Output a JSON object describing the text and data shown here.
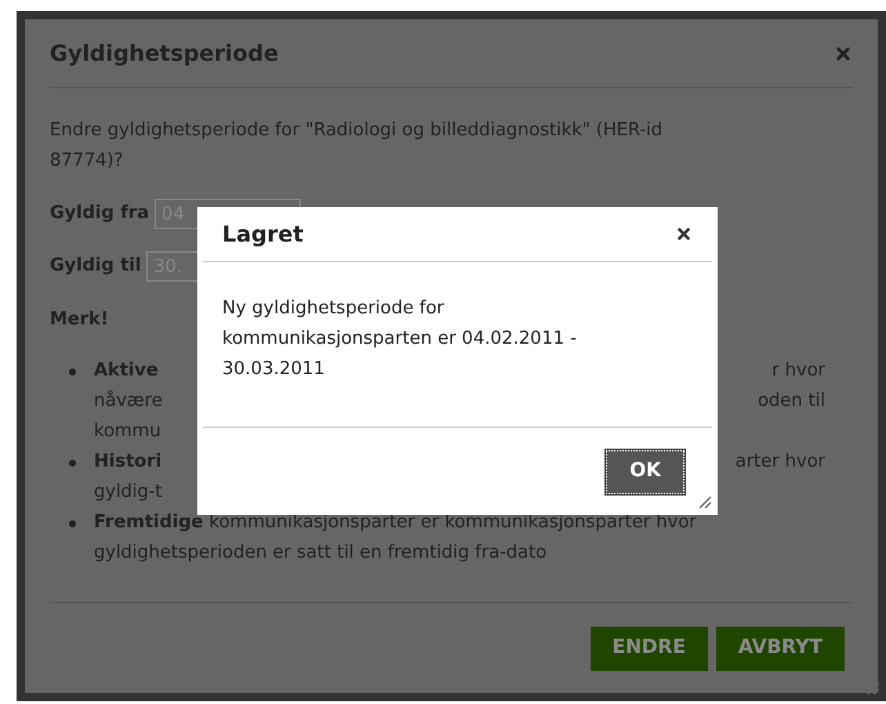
{
  "dialog": {
    "title": "Gyldighetsperiode",
    "question": "Endre gyldighetsperiode for \"Radiologi og billeddiagnostikk\" (HER-id 87774)?",
    "fields": [
      {
        "label": "Gyldig fra",
        "value": "04"
      },
      {
        "label": "Gyldig til",
        "value": "30."
      }
    ],
    "note_heading": "Merk!",
    "bullets": [
      {
        "lines": [
          {
            "term": "Aktive",
            "right": "r hvor"
          },
          {
            "left": "nåvære",
            "right": "oden til"
          },
          {
            "left": "kommu"
          }
        ]
      },
      {
        "lines": [
          {
            "term": "Histori",
            "right": "arter hvor"
          },
          {
            "left": "gyldig-t"
          }
        ]
      },
      {
        "term": "Fremtidige",
        "text": "kommunikasjonsparter er kommunikasjonsparter hvor gyldighetsperioden er satt til en fremtidig fra-dato"
      }
    ],
    "buttons": [
      "ENDRE",
      "AVBRYT"
    ]
  },
  "alert": {
    "title": "Lagret",
    "message": "Ny gyldighetsperiode for kommunikasjonsparten er 04.02.2011 - 30.03.2011",
    "buttons": [
      "OK"
    ]
  }
}
